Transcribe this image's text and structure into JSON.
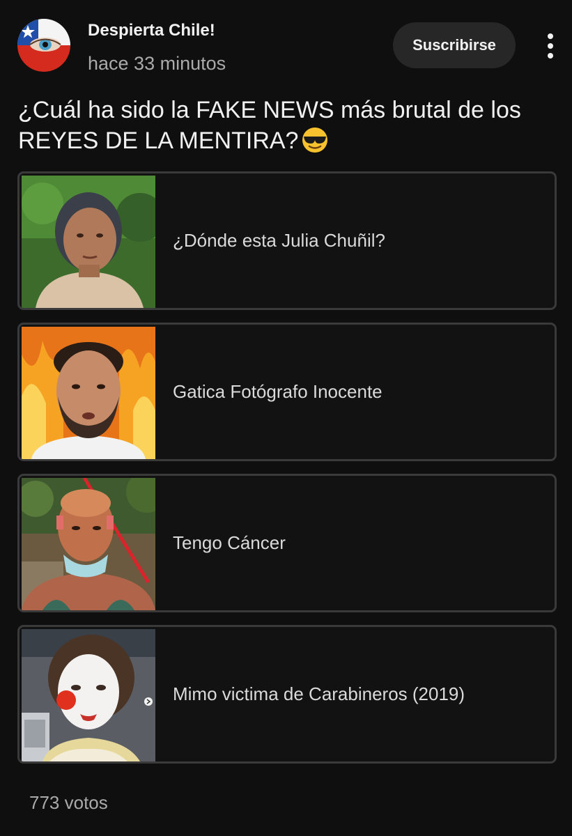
{
  "post": {
    "channel_name": "Despierta Chile!",
    "timestamp": "hace 33 minutos",
    "subscribe_label": "Suscribirse",
    "avatar_icon": "chile-flag-eye-avatar-icon",
    "more_icon": "vertical-ellipsis-icon",
    "question": "¿Cuál ha sido la FAKE NEWS más brutal de los REYES DE LA MENTIRA?",
    "question_emoji": "😎",
    "question_emoji_icon": "smiling-face-with-sunglasses-icon"
  },
  "poll": {
    "options": [
      {
        "label": "¿Dónde esta Julia Chuñil?",
        "thumbnail": "elderly-woman-portrait"
      },
      {
        "label": "Gatica Fotógrafo Inocente",
        "thumbnail": "man-in-front-of-fire"
      },
      {
        "label": "Tengo Cáncer",
        "thumbnail": "bald-man-with-mask-protest"
      },
      {
        "label": "Mimo victima de Carabineros (2019)",
        "thumbnail": "mime-with-clown-nose"
      }
    ],
    "votes": "773 votos"
  },
  "colors": {
    "background": "#0f0f0f",
    "text_primary": "#f1f1f1",
    "text_secondary": "#aaaaaa",
    "option_border": "#3a3a3a",
    "subscribe_bg": "#272727"
  }
}
